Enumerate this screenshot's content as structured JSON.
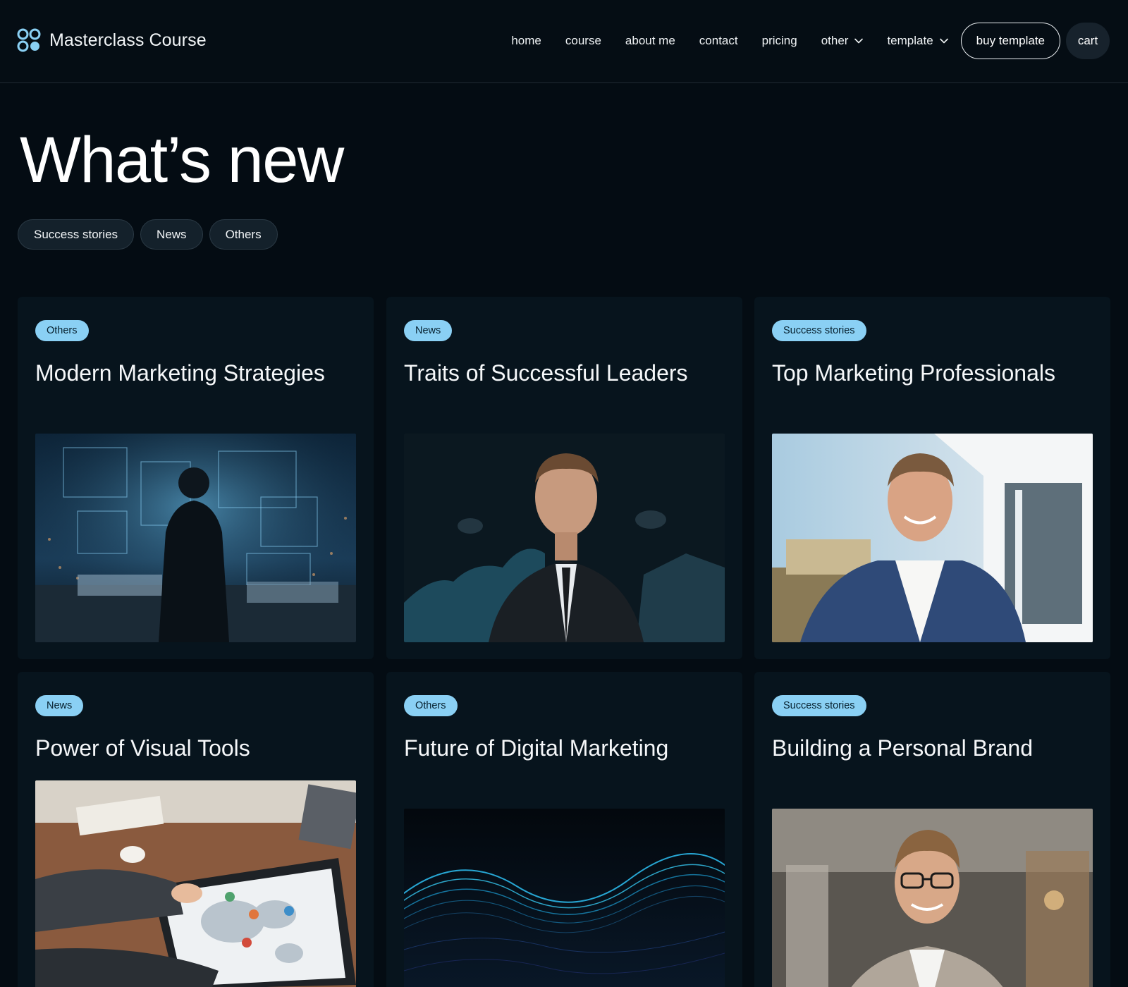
{
  "brand": {
    "name": "Masterclass Course",
    "icon": "logo-icon"
  },
  "nav": {
    "links": [
      "home",
      "course",
      "about me",
      "contact",
      "pricing"
    ],
    "dropdowns": [
      "other",
      "template"
    ],
    "buy_label": "buy template",
    "cart_label": "cart"
  },
  "page": {
    "title": "What’s new"
  },
  "filters": [
    "Success stories",
    "News",
    "Others"
  ],
  "cards": [
    {
      "tag": "Others",
      "title": "Modern Marketing Strategies",
      "image": "man-facing-holographic-city-screens"
    },
    {
      "tag": "News",
      "title": "Traits of Successful Leaders",
      "image": "businessman-portrait-with-charts"
    },
    {
      "tag": "Success stories",
      "title": "Top Marketing Professionals",
      "image": "smiling-man-blue-blazer-modern-house"
    },
    {
      "tag": "News",
      "title": "Power of Visual Tools",
      "image": "hands-on-tablet-with-map"
    },
    {
      "tag": "Others",
      "title": "Future of Digital Marketing",
      "image": "glowing-digital-wave"
    },
    {
      "tag": "Success stories",
      "title": "Building a Personal Brand",
      "image": "smiling-man-with-glasses-office"
    }
  ],
  "colors": {
    "background": "#040c13",
    "card": "#07141d",
    "tag": "#8ad0f4",
    "chip": "#14212b",
    "logo_accent": "#8ad0f4"
  }
}
